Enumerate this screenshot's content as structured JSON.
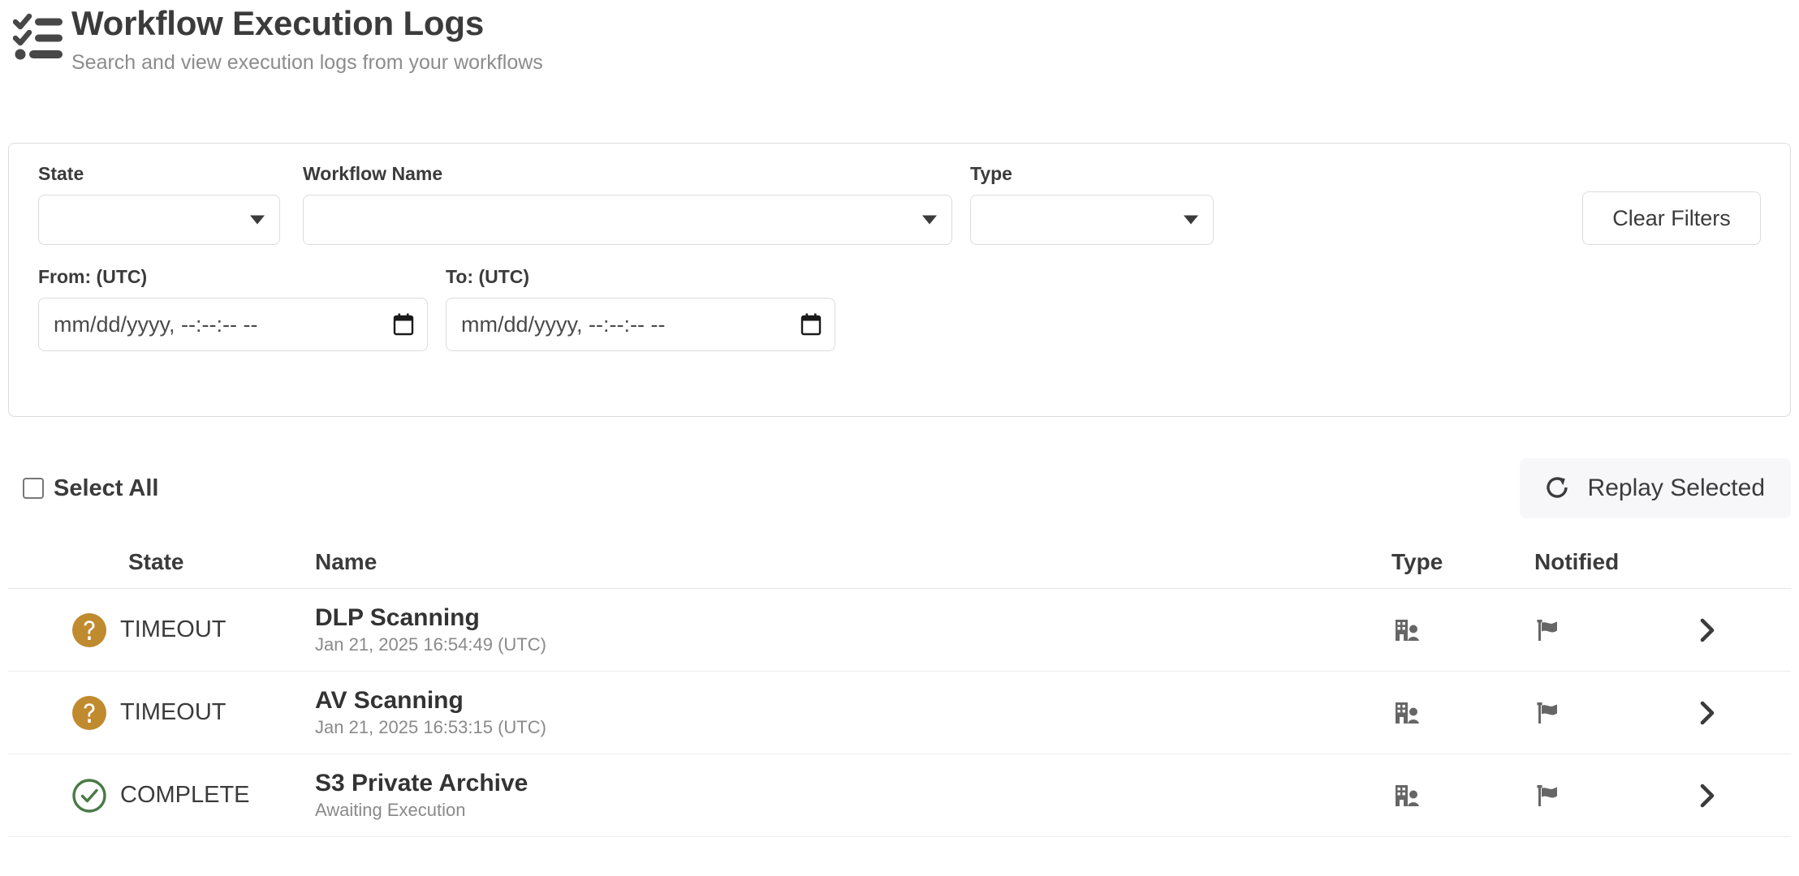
{
  "header": {
    "icon": "checklist-icon",
    "title": "Workflow Execution Logs",
    "subtitle": "Search and view execution logs from your workflows"
  },
  "filters": {
    "state": {
      "label": "State",
      "value": "",
      "caret_icon": "chevron-down-icon"
    },
    "workflow_name": {
      "label": "Workflow Name",
      "value": "",
      "caret_icon": "chevron-down-icon"
    },
    "type": {
      "label": "Type",
      "value": "",
      "caret_icon": "chevron-down-icon"
    },
    "clear_button": "Clear Filters",
    "from": {
      "label": "From: (UTC)",
      "value": "",
      "placeholder": "mm/dd/yyyy, --:--:-- --",
      "icon": "calendar-icon"
    },
    "to": {
      "label": "To: (UTC)",
      "value": "",
      "placeholder": "mm/dd/yyyy, --:--:-- --",
      "icon": "calendar-icon"
    }
  },
  "actions": {
    "select_all_label": "Select All",
    "select_all_checked": false,
    "replay_label": "Replay Selected",
    "replay_icon": "refresh-icon"
  },
  "table": {
    "columns": {
      "state": "State",
      "name": "Name",
      "type": "Type",
      "notified": "Notified"
    },
    "rows": [
      {
        "state": "TIMEOUT",
        "state_icon": "question-circle-icon",
        "state_color": "#c08a2e",
        "name": "DLP Scanning",
        "subtitle": "Jan 21, 2025 16:54:49 (UTC)",
        "type_icon": "building-user-icon",
        "notified_icon": "flag-icon",
        "chevron_icon": "chevron-right-icon"
      },
      {
        "state": "TIMEOUT",
        "state_icon": "question-circle-icon",
        "state_color": "#c08a2e",
        "name": "AV Scanning",
        "subtitle": "Jan 21, 2025 16:53:15 (UTC)",
        "type_icon": "building-user-icon",
        "notified_icon": "flag-icon",
        "chevron_icon": "chevron-right-icon"
      },
      {
        "state": "COMPLETE",
        "state_icon": "check-circle-icon",
        "state_color": "#4a7a46",
        "name": "S3 Private Archive",
        "subtitle": "Awaiting Execution",
        "type_icon": "building-user-icon",
        "notified_icon": "flag-icon",
        "chevron_icon": "chevron-right-icon"
      }
    ]
  },
  "colors": {
    "text_primary": "#3b3b3b",
    "text_muted": "#8a8a8a",
    "border": "#dcdcdc",
    "timeout_amber": "#c08a2e",
    "complete_green": "#4a7a46",
    "replay_bg": "#f7f7f9"
  }
}
